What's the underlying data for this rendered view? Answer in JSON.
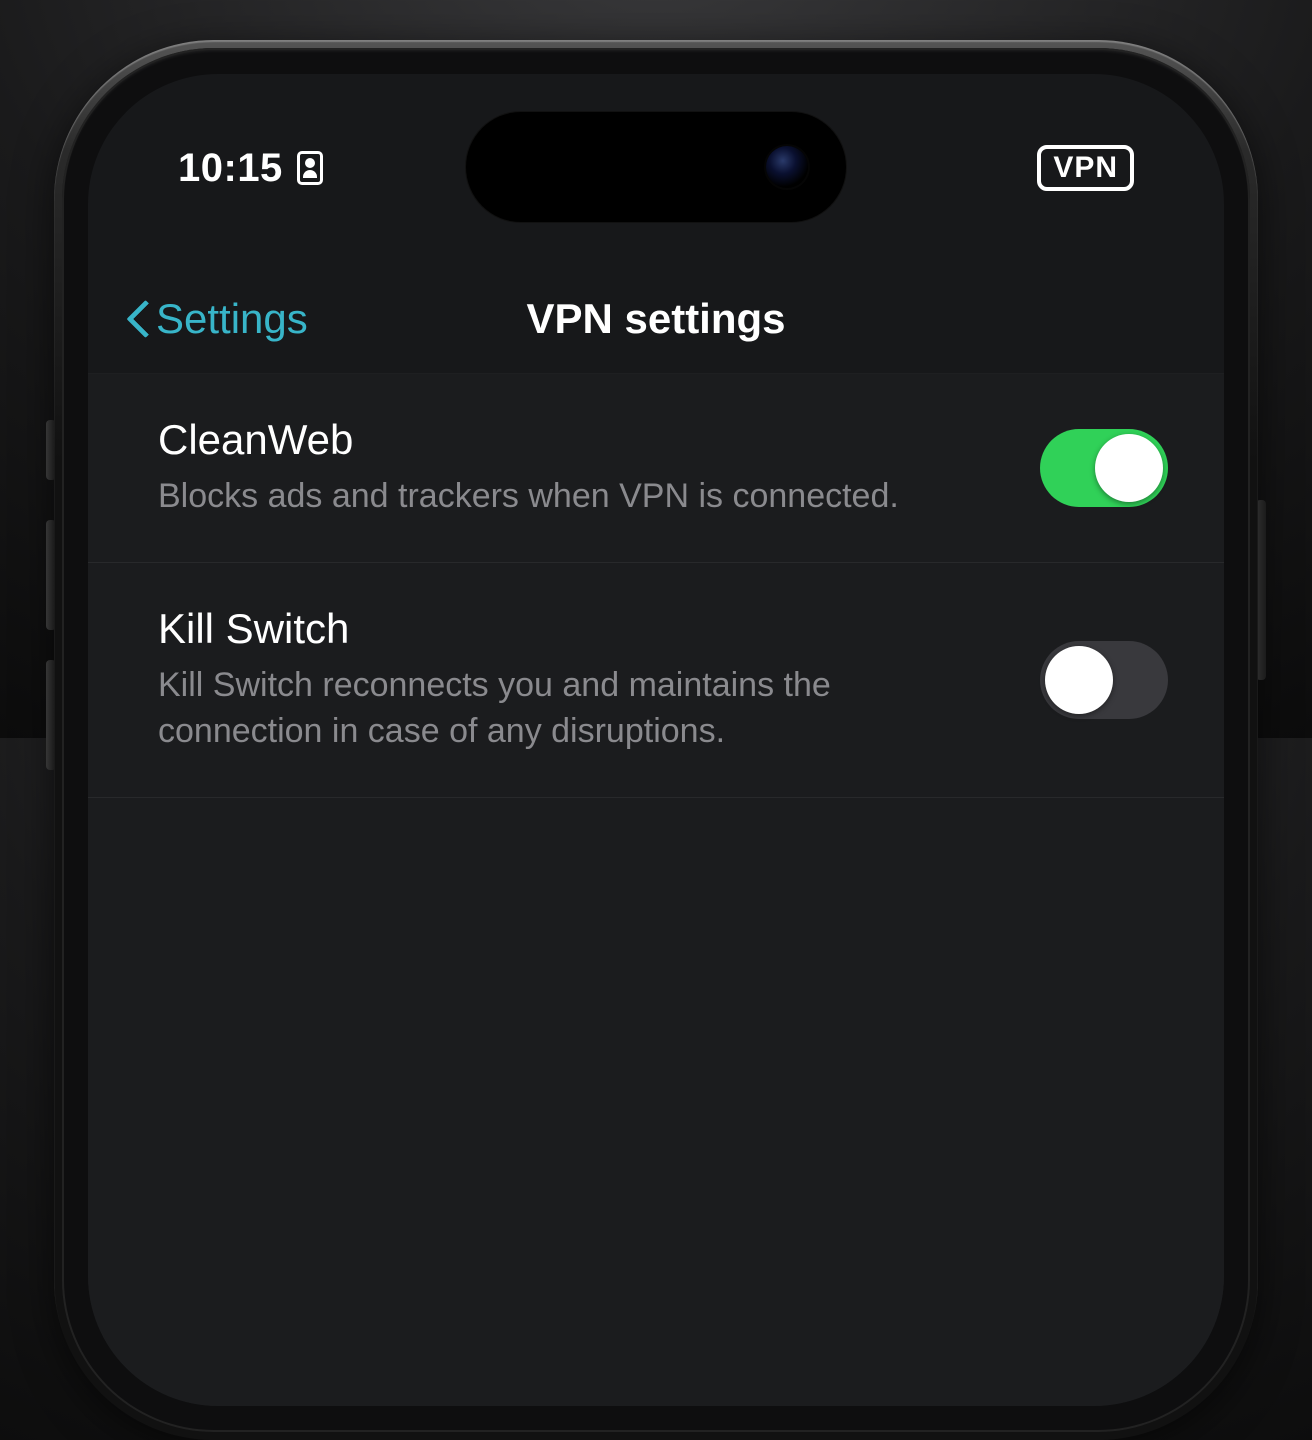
{
  "status": {
    "time": "10:15",
    "vpn_badge": "VPN"
  },
  "nav": {
    "back_label": "Settings",
    "title": "VPN settings"
  },
  "rows": [
    {
      "title": "CleanWeb",
      "subtitle": "Blocks ads and trackers when VPN is connected.",
      "toggle_on": true
    },
    {
      "title": "Kill Switch",
      "subtitle": "Kill Switch reconnects you and maintains the connection in case of any disruptions.",
      "toggle_on": false
    }
  ],
  "colors": {
    "accent": "#38b5c9",
    "toggle_on": "#30d158"
  }
}
